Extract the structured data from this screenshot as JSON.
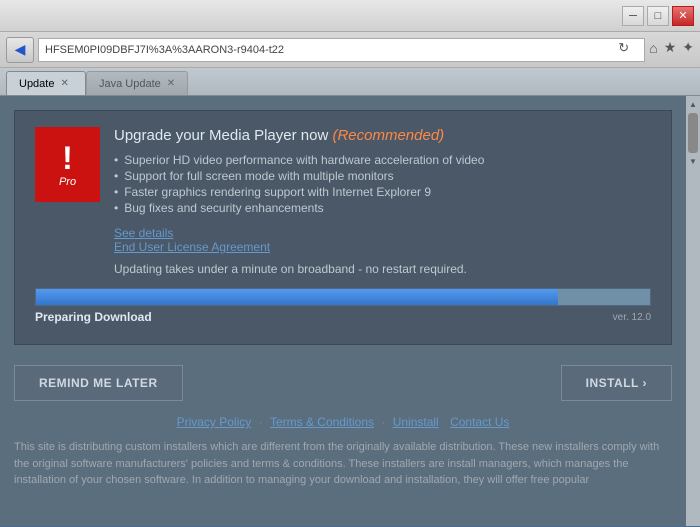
{
  "browser": {
    "address": "HFSEM0PI09DBFJ7I%3A%3AARON3-r9404-t22",
    "tab1_label": "Update",
    "tab2_label": "Java Update",
    "back_icon": "◀",
    "refresh_icon": "↻",
    "search_icon": "🔍",
    "bookmark_icon": "★",
    "home_icon": "⌂",
    "settings_icon": "✦",
    "close_win": "✕",
    "min_win": "─",
    "max_win": "□",
    "scrollbar_up": "▲",
    "scrollbar_down": "▼"
  },
  "panel": {
    "title": "Upgrade your Media Player now",
    "recommended": "(Recommended)",
    "pro_label": "Pro",
    "exclamation": "!",
    "features": [
      "Superior HD video performance with hardware acceleration of video",
      "Support for full screen mode with multiple monitors",
      "Faster graphics rendering support with Internet Explorer 9",
      "Bug fixes and security enhancements"
    ],
    "see_details": "See details",
    "eula": "End User License Agreement",
    "update_note": "Updating takes under a minute on broadband - no restart required.",
    "preparing": "Preparing Download",
    "version": "ver. 12.0",
    "progress_pct": 85
  },
  "buttons": {
    "remind_later": "REMIND ME LATER",
    "install": "INSTALL ›"
  },
  "footer": {
    "privacy": "Privacy Policy",
    "terms": "Terms & Conditions",
    "uninstall": "Uninstall",
    "contact": "Contact Us",
    "body_text": "This site is distributing custom installers which are different from the originally available distribution. These new installers comply with the original software manufacturers' policies and terms & conditions. These installers are install managers, which manages the installation of your chosen software. In addition to managing your download and installation, they will offer free popular"
  }
}
